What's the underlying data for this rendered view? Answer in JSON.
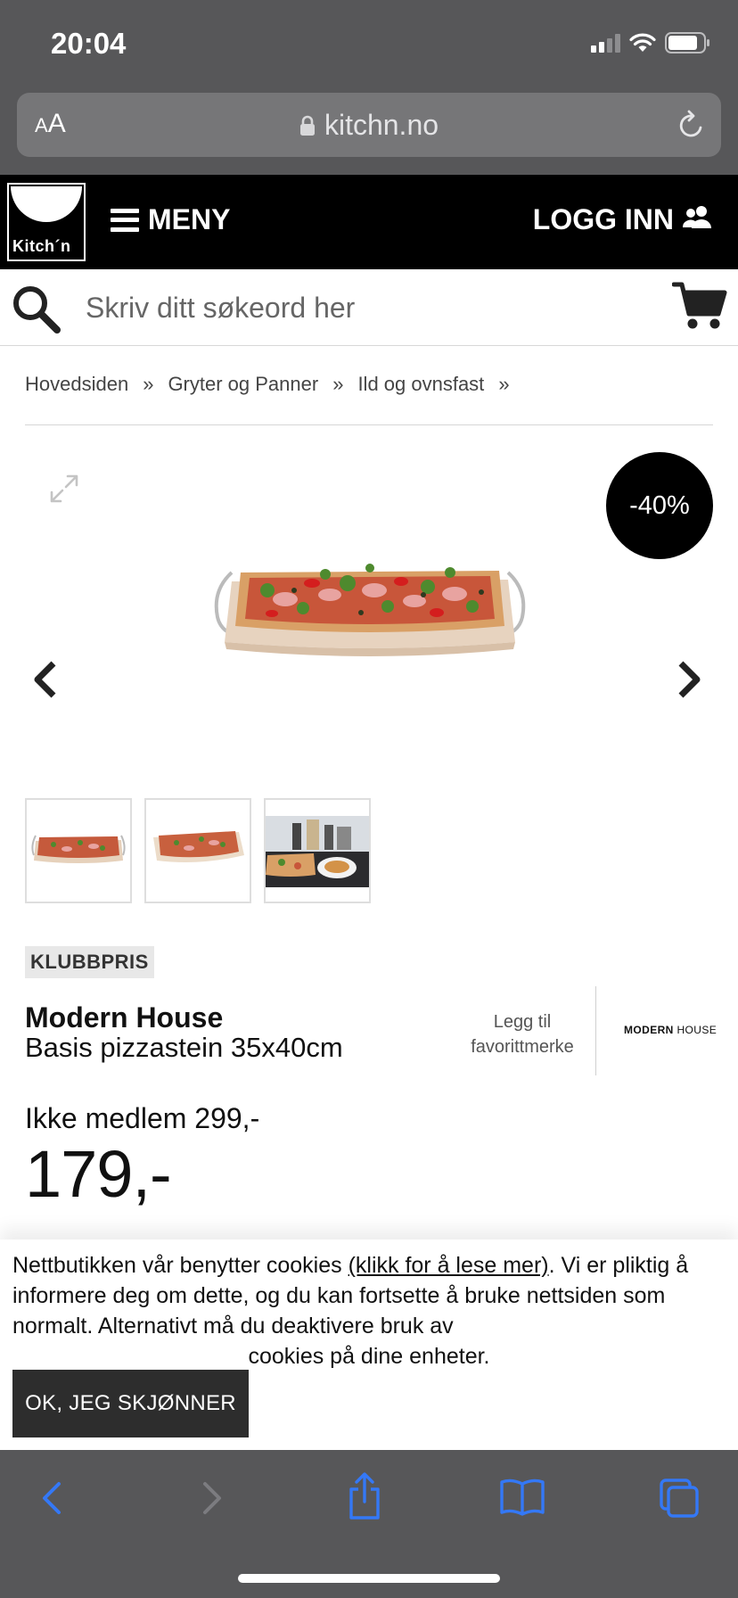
{
  "status_bar": {
    "time": "20:04"
  },
  "browser": {
    "text_size_label_small": "A",
    "text_size_label_large": "A",
    "url": "kitchn.no"
  },
  "header": {
    "logo_text": "Kitch´n",
    "menu_label": "MENY",
    "login_label": "LOGG INN"
  },
  "search": {
    "placeholder": "Skriv ditt søkeord her"
  },
  "breadcrumb": {
    "items": [
      "Hovedsiden",
      "Gryter og Panner",
      "Ild og ovnsfast"
    ],
    "separator": "»"
  },
  "gallery": {
    "discount_badge": "-40%",
    "thumbnail_count": 3
  },
  "product": {
    "badge": "KLUBBPRIS",
    "brand": "Modern House",
    "name": "Basis pizzastein 35x40cm",
    "favorite_link_line1": "Legg til",
    "favorite_link_line2": "favorittmerke",
    "brand_logo_bold": "MODERN",
    "brand_logo_light": "HOUSE",
    "regular_price": "Ikke medlem 299,-",
    "club_price": "179,-"
  },
  "cookie": {
    "text_before": "Nettbutikken vår benytter cookies ",
    "link_text": "(klikk for å lese mer)",
    "text_after": ". Vi er pliktig å informere deg om dette, og du kan fortsette å bruke nettsiden som normalt. Alternativt må du deaktivere bruk av",
    "text_last": "cookies på dine enheter.",
    "button_label": "OK, JEG SKJØNNER"
  },
  "colors": {
    "browser_chrome": "#575759",
    "site_header": "#000000",
    "toolbar_accent": "#3478f6",
    "cookie_button": "#2d2d2d"
  }
}
